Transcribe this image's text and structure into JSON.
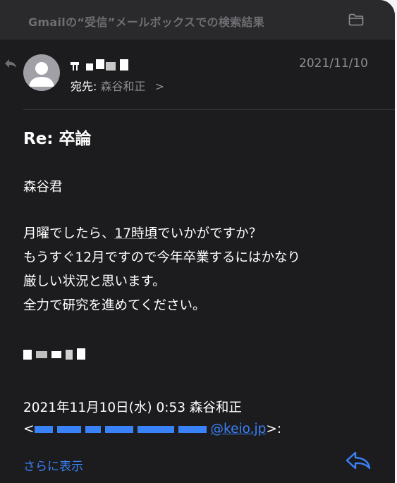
{
  "banner": {
    "title": "Gmailの“受信”メールボックスでの検索結果",
    "folder_icon": "folder-icon"
  },
  "message": {
    "sender_name": "",
    "recipient_label": "宛先:",
    "recipient_name": "森谷和正",
    "recipient_chevron": ">",
    "date": "2021/11/10",
    "subject": "Re: 卒論"
  },
  "body": {
    "greeting": "森谷君",
    "line1_before": "月曜でしたら、",
    "line1_underlined": "17時頃",
    "line1_after": "でいかがですか？",
    "line2": "もうすぐ12月ですので今年卒業するにはかなり",
    "line3": "厳しい状況と思います。",
    "line4": "全力で研究を進めてください。",
    "signature": ""
  },
  "quote": {
    "header": "2021年11月10日(水) 0:53 森谷和正",
    "email_prefix": "<",
    "email_domain": "@keio.jp",
    "email_suffix": ">:"
  },
  "footer": {
    "show_more": "さらに表示",
    "reply_icon": "reply-icon"
  },
  "colors": {
    "background": "#1c1c1e",
    "banner": "#2a2a2c",
    "link": "#3a82f7",
    "secondary_text": "#8e8e93"
  }
}
